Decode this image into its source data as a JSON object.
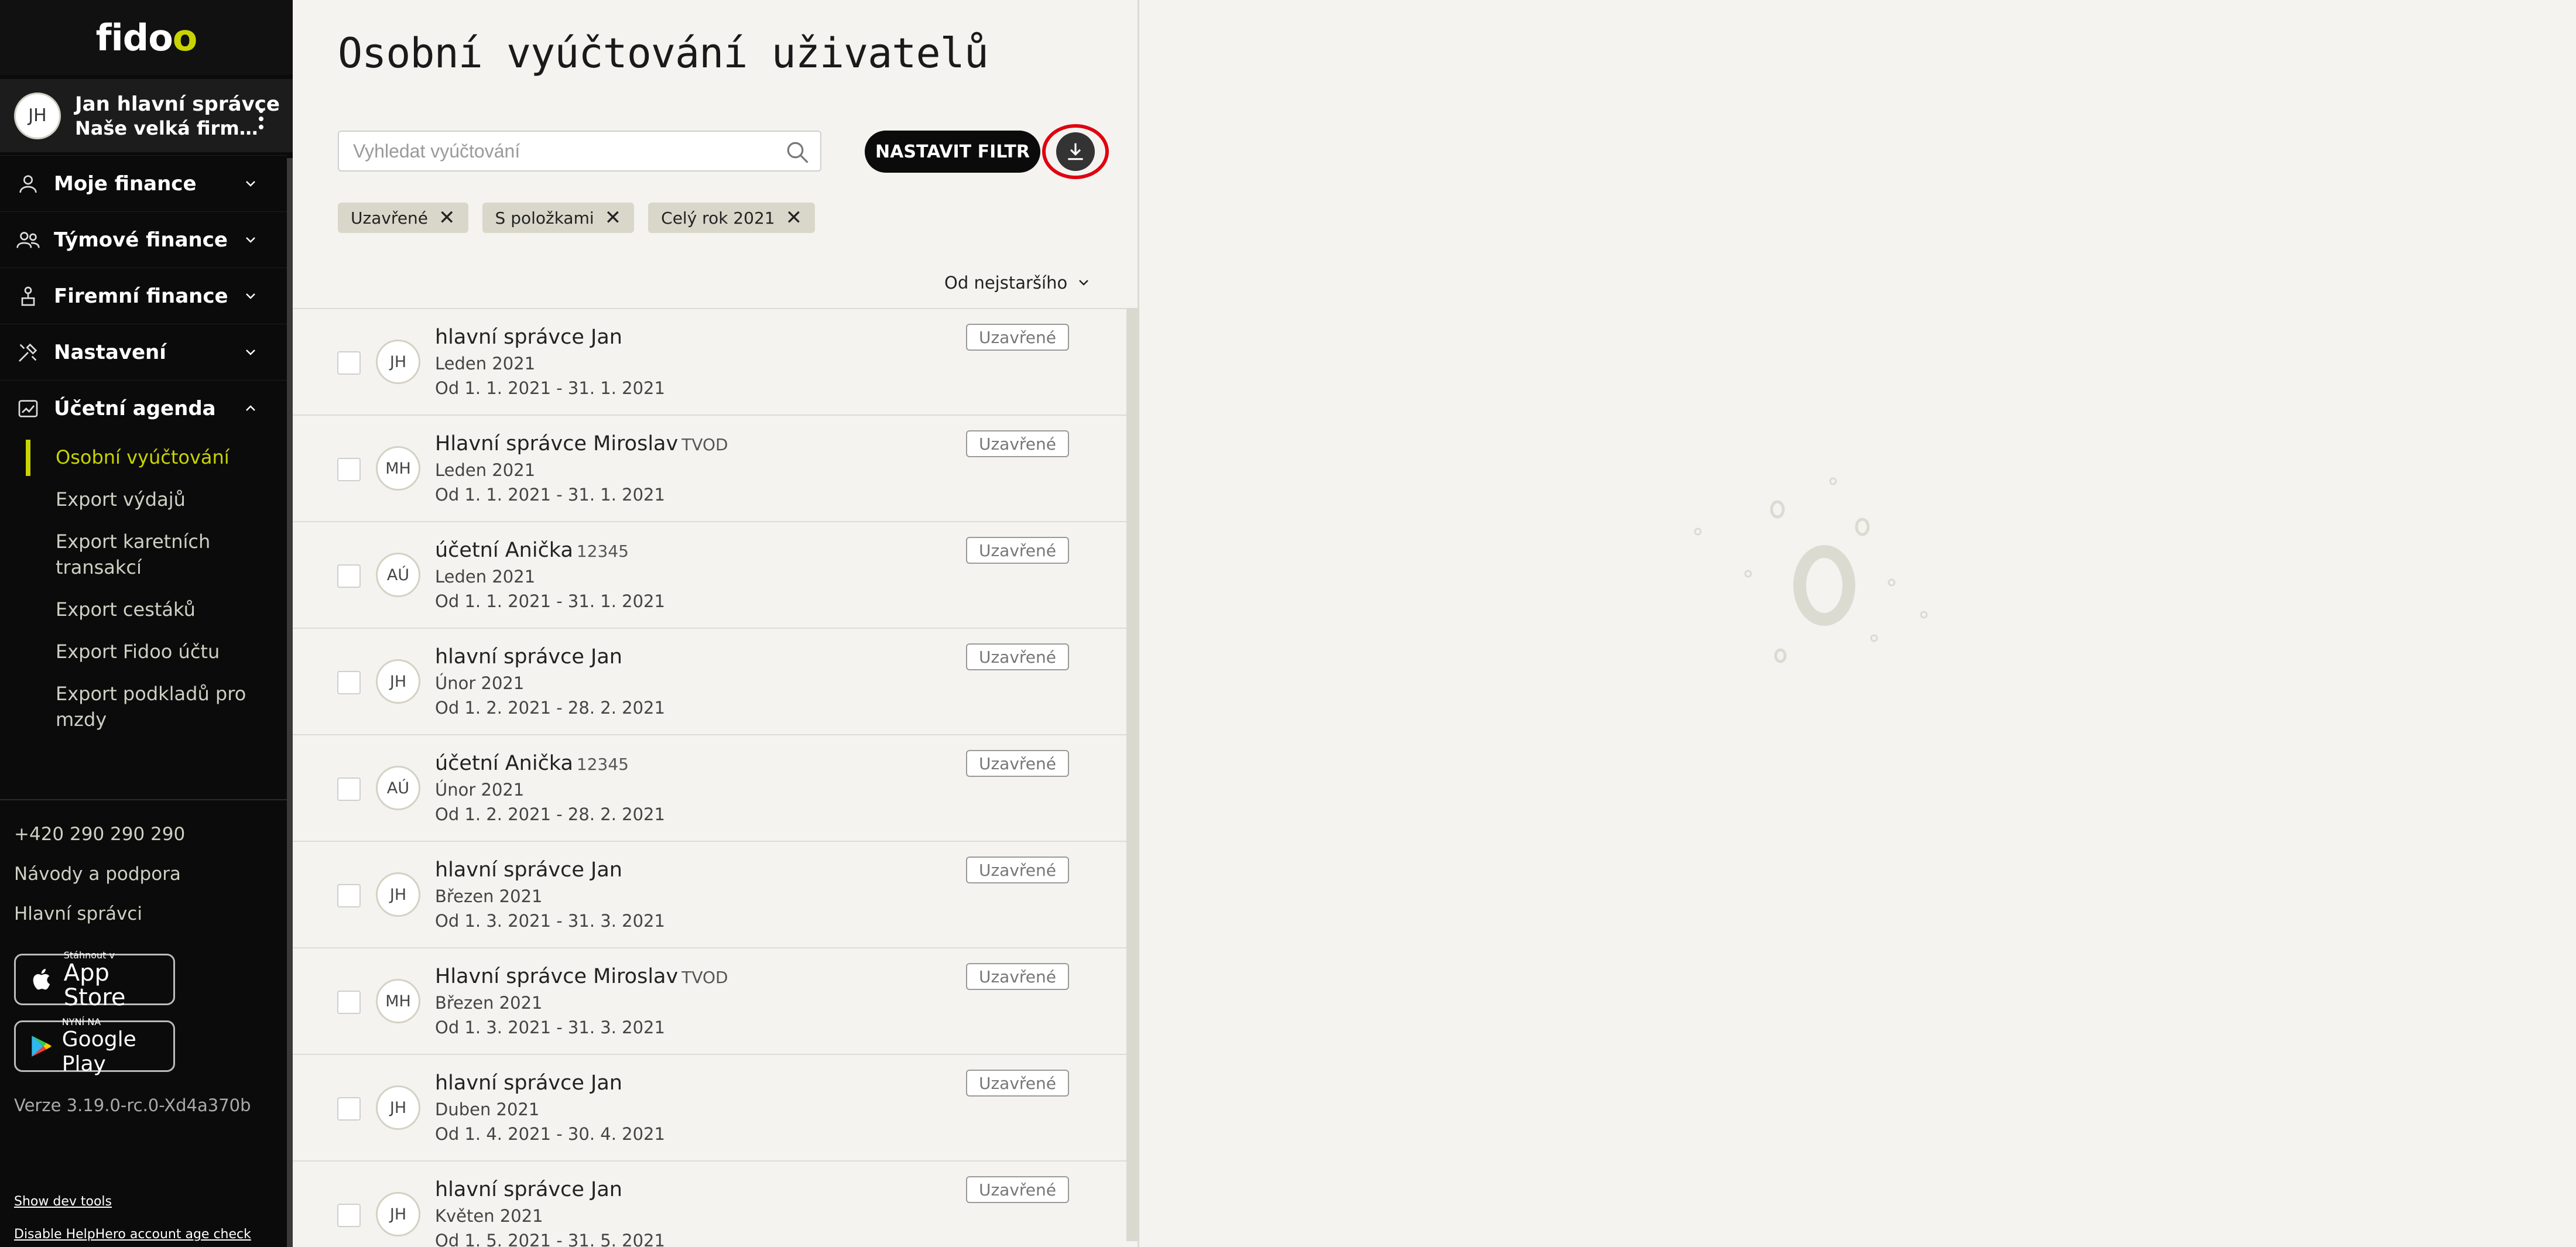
{
  "sidebar": {
    "logo": {
      "part1": "fid",
      "part2": "o",
      "part3": "o"
    },
    "user": {
      "initials": "JH",
      "name": "Jan hlavní správce",
      "company": "Naše velká firma, a.s."
    },
    "nav": [
      {
        "label": "Moje finance",
        "icon": "person-icon"
      },
      {
        "label": "Týmové finance",
        "icon": "team-icon"
      },
      {
        "label": "Firemní finance",
        "icon": "company-icon"
      },
      {
        "label": "Nastavení",
        "icon": "tools-icon"
      },
      {
        "label": "Účetní agenda",
        "icon": "chart-icon"
      }
    ],
    "sub": [
      "Osobní vyúčtování",
      "Export výdajů",
      "Export karetních transakcí",
      "Export cestáků",
      "Export Fidoo účtu",
      "Export podkladů pro mzdy"
    ],
    "phone": "+420 290 290 290",
    "help": "Návody a podpora",
    "admins": "Hlavní správci",
    "appstore": {
      "small": "Stáhnout v",
      "big": "App Store"
    },
    "googleplay": {
      "small": "NYNÍ NA",
      "big": "Google Play"
    },
    "version": "Verze 3.19.0-rc.0-Xd4a370b",
    "dev_tools": "Show dev tools",
    "helphero": "Disable HelpHero account age check"
  },
  "main": {
    "title": "Osobní vyúčtování uživatelů",
    "search_placeholder": "Vyhledat vyúčtování",
    "filter_button": "NASTAVIT FILTR",
    "chips": [
      "Uzavřené",
      "S položkami",
      "Celý rok 2021"
    ],
    "sort_label": "Od nejstaršího",
    "rows": [
      {
        "initials": "JH",
        "name": "hlavní správce Jan",
        "tag": "",
        "period": "Leden 2021",
        "dates": "Od 1. 1. 2021 - 31. 1. 2021",
        "status": "Uzavřené"
      },
      {
        "initials": "MH",
        "name": "Hlavní správce Miroslav",
        "tag": "TVOD",
        "period": "Leden 2021",
        "dates": "Od 1. 1. 2021 - 31. 1. 2021",
        "status": "Uzavřené"
      },
      {
        "initials": "AÚ",
        "name": "účetní Anička",
        "tag": "12345",
        "period": "Leden 2021",
        "dates": "Od 1. 1. 2021 - 31. 1. 2021",
        "status": "Uzavřené"
      },
      {
        "initials": "JH",
        "name": "hlavní správce Jan",
        "tag": "",
        "period": "Únor 2021",
        "dates": "Od 1. 2. 2021 - 28. 2. 2021",
        "status": "Uzavřené"
      },
      {
        "initials": "AÚ",
        "name": "účetní Anička",
        "tag": "12345",
        "period": "Únor 2021",
        "dates": "Od 1. 2. 2021 - 28. 2. 2021",
        "status": "Uzavřené"
      },
      {
        "initials": "JH",
        "name": "hlavní správce Jan",
        "tag": "",
        "period": "Březen 2021",
        "dates": "Od 1. 3. 2021 - 31. 3. 2021",
        "status": "Uzavřené"
      },
      {
        "initials": "MH",
        "name": "Hlavní správce Miroslav",
        "tag": "TVOD",
        "period": "Březen 2021",
        "dates": "Od 1. 3. 2021 - 31. 3. 2021",
        "status": "Uzavřené"
      },
      {
        "initials": "JH",
        "name": "hlavní správce Jan",
        "tag": "",
        "period": "Duben 2021",
        "dates": "Od 1. 4. 2021 - 30. 4. 2021",
        "status": "Uzavřené"
      },
      {
        "initials": "JH",
        "name": "hlavní správce Jan",
        "tag": "",
        "period": "Květen 2021",
        "dates": "Od 1. 5. 2021 - 31. 5. 2021",
        "status": "Uzavřené"
      }
    ]
  },
  "colors": {
    "accent": "#c8d400",
    "sidebar_bg": "#0b0b0b",
    "highlight": "#e00010"
  }
}
